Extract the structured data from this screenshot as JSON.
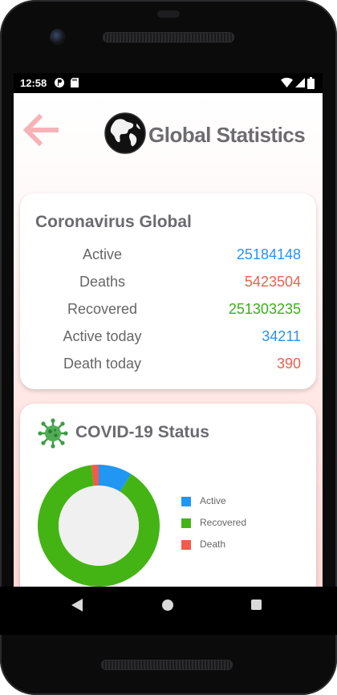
{
  "status_bar": {
    "time": "12:58"
  },
  "header": {
    "title": "Global Statistics",
    "back_icon": "back-arrow-icon",
    "globe_icon": "globe-icon"
  },
  "global_card": {
    "title": "Coronavirus Global",
    "rows": [
      {
        "label": "Active",
        "value": "25184148",
        "color": "#2a92f2"
      },
      {
        "label": "Deaths",
        "value": "5423504",
        "color": "#ee5f4c"
      },
      {
        "label": "Recovered",
        "value": "251303235",
        "color": "#3cae1a"
      },
      {
        "label": "Active today",
        "value": "34211",
        "color": "#2a92f2"
      },
      {
        "label": "Death today",
        "value": "390",
        "color": "#ee5f4c"
      }
    ]
  },
  "status_card": {
    "title": "COVID-19 Status",
    "icon": "virus-icon",
    "legend": [
      {
        "label": "Active",
        "color": "#2196f3"
      },
      {
        "label": "Recovered",
        "color": "#44b414"
      },
      {
        "label": "Death",
        "color": "#f25a4a"
      }
    ]
  },
  "chart_data": {
    "type": "pie",
    "variant": "donut",
    "categories": [
      "Active",
      "Recovered",
      "Death"
    ],
    "values": [
      25184148,
      251303235,
      5423504
    ],
    "colors": [
      "#2196f3",
      "#44b414",
      "#f25a4a"
    ],
    "legend_position": "right"
  },
  "nav": {
    "back_icon": "nav-back-icon",
    "home_icon": "nav-home-icon",
    "recents_icon": "nav-recents-icon"
  }
}
